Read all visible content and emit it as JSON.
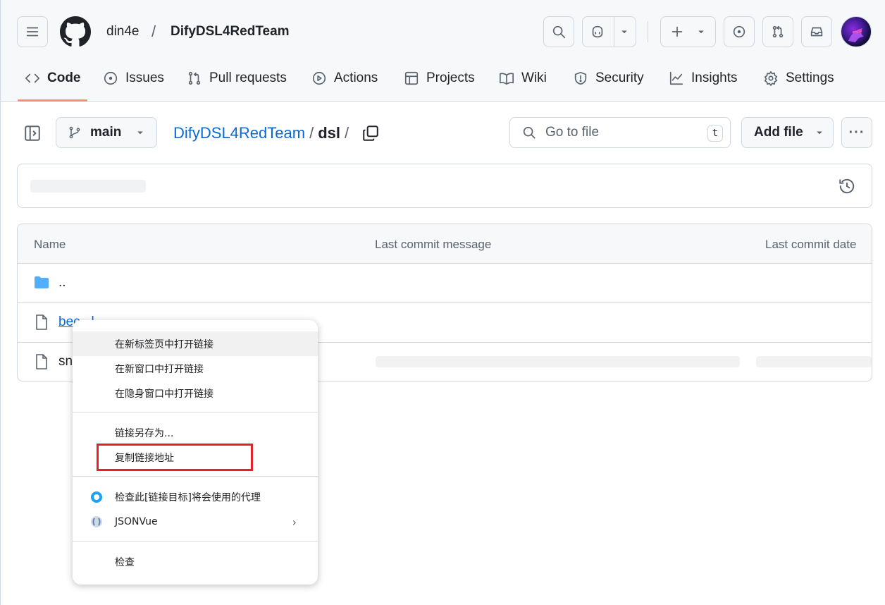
{
  "header": {
    "owner": "din4e",
    "separator": "/",
    "repo": "DifyDSL4RedTeam"
  },
  "tabs": [
    {
      "label": "Code",
      "icon": "code-icon",
      "active": true
    },
    {
      "label": "Issues",
      "icon": "issue-icon"
    },
    {
      "label": "Pull requests",
      "icon": "pull-request-icon"
    },
    {
      "label": "Actions",
      "icon": "play-icon"
    },
    {
      "label": "Projects",
      "icon": "table-icon"
    },
    {
      "label": "Wiki",
      "icon": "book-icon"
    },
    {
      "label": "Security",
      "icon": "shield-icon"
    },
    {
      "label": "Insights",
      "icon": "graph-icon"
    },
    {
      "label": "Settings",
      "icon": "gear-icon"
    }
  ],
  "toolbar": {
    "branch": "main",
    "breadcrumb_repo": "DifyDSL4RedTeam",
    "breadcrumb_sep": "/",
    "breadcrumb_current": "dsl",
    "breadcrumb_trailing": "/",
    "goto_placeholder": "Go to file",
    "goto_shortcut": "t",
    "add_file_label": "Add file",
    "more_label": "···"
  },
  "table": {
    "headers": {
      "name": "Name",
      "message": "Last commit message",
      "date": "Last commit date"
    },
    "rows": [
      {
        "name": "..",
        "icon": "folder-icon"
      },
      {
        "name": "bec...l",
        "icon": "file-icon",
        "link": true
      },
      {
        "name": "sn",
        "icon": "file-icon"
      }
    ]
  },
  "context_menu": {
    "items": [
      "在新标签页中打开链接",
      "在新窗口中打开链接",
      "在隐身窗口中打开链接",
      "链接另存为...",
      "复制链接地址",
      "检查此[链接目标]将会使用的代理",
      "JSONVue",
      "检查"
    ],
    "submenu_arrow": "›"
  },
  "colors": {
    "accent_blue": "#0969da",
    "tab_underline": "#fd8c73",
    "highlight_red": "#e0202a",
    "folder_blue": "#54aeff"
  }
}
